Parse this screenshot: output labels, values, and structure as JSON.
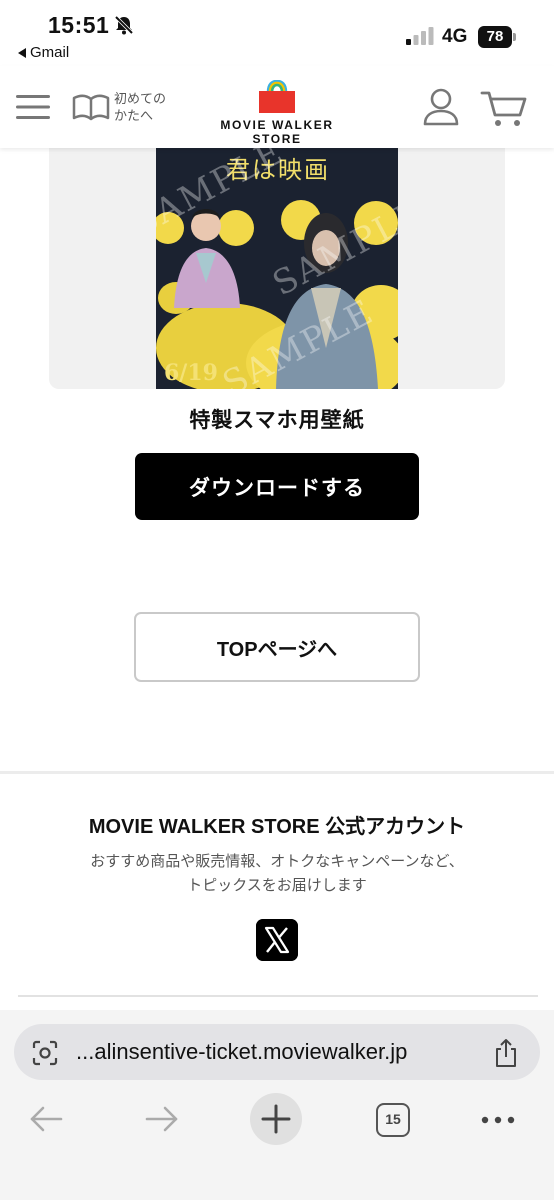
{
  "status_bar": {
    "time": "15:51",
    "back_app": "Gmail",
    "network": "4G",
    "battery": "78"
  },
  "header": {
    "beginner_line1": "初めての",
    "beginner_line2": "かたへ",
    "logo_text": "MOVIE WALKER STORE"
  },
  "poster": {
    "title": "君は映画",
    "date": "6/19",
    "watermark": "SAMPLE"
  },
  "wallpaper": {
    "caption": "特製スマホ用壁紙",
    "download_label": "ダウンロードする"
  },
  "top_page_label": "TOPページへ",
  "official": {
    "title": "MOVIE WALKER STORE 公式アカウント",
    "desc_line1": "おすすめ商品や販売情報、オトクなキャンペーンなど、",
    "desc_line2": "トピックスをお届けします"
  },
  "browser": {
    "url": "...alinsentive-ticket.moviewalker.jp",
    "tab_count": "15"
  },
  "colors": {
    "brand_red": "#e8342b",
    "poster_yellow": "#f2d94a",
    "button_black": "#000000"
  }
}
